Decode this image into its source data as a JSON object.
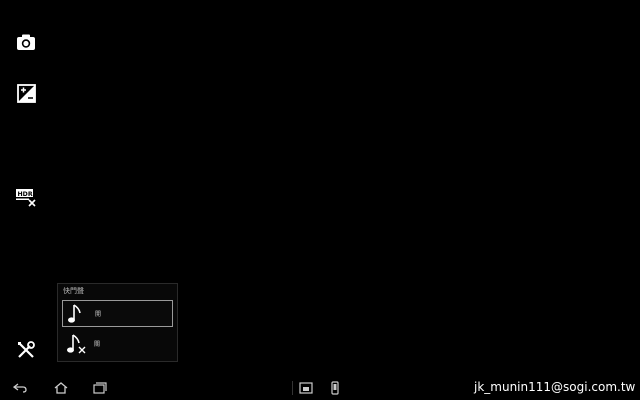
{
  "popup": {
    "title": "快門聲",
    "options": [
      {
        "label": "開",
        "icon": "music-note-icon",
        "selected": true
      },
      {
        "label": "關",
        "icon": "music-note-muted-icon",
        "selected": false
      }
    ]
  },
  "sidebar": {
    "icons": [
      "camera-icon",
      "exposure-icon",
      "hdr-off-icon",
      "settings-tools-icon"
    ]
  },
  "navbar": {
    "icons": [
      "back-icon",
      "home-icon",
      "recent-apps-icon",
      "screen-mode-icon",
      "phone-mode-icon"
    ]
  },
  "watermark": "jk_munin111@sogi.com.tw",
  "colors": {
    "background": "#000000",
    "foreground": "#ffffff",
    "selected_border": "#9a9a9a"
  }
}
